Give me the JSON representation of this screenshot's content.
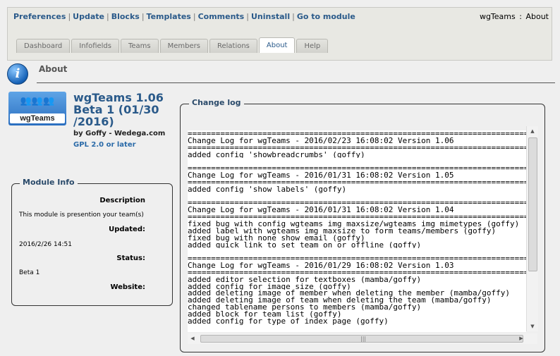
{
  "toplinks": [
    "Preferences",
    "Update",
    "Blocks",
    "Templates",
    "Comments",
    "Uninstall",
    "Go to module"
  ],
  "toplinks_sep": "|",
  "brand": {
    "module": "wgTeams",
    "sep": ":",
    "page": "About"
  },
  "tabs": [
    "Dashboard",
    "Infofields",
    "Teams",
    "Members",
    "Relations",
    "About",
    "Help"
  ],
  "active_tab": "About",
  "page_title": "About",
  "info_icon": {
    "name": "info-icon",
    "glyph": "i"
  },
  "logo": {
    "text": "wgTeams",
    "icon": "people-icon",
    "glyph": "👥👥👥"
  },
  "module": {
    "title": "wgTeams 1.06 Beta 1 (01/30 /2016)",
    "by": "by Goffy - Wedega.com",
    "license": "GPL 2.0 or later"
  },
  "module_info": {
    "legend": "Module Info",
    "description_label": "Description",
    "description": "This module is presention your team(s)",
    "updated_label": "Updated:",
    "updated": "2016/2/26 14:51",
    "status_label": "Status:",
    "status": "Beta 1",
    "website_label": "Website:"
  },
  "changelog": {
    "legend": "Change log",
    "lines": [
      "==========================================================================",
      "Change Log for wgTeams - 2016/02/23 16:08:02 Version 1.06",
      "==========================================================================",
      "added config 'showbreadcrumbs' (goffy)",
      "",
      "==========================================================================",
      "Change Log for wgTeams - 2016/01/31 16:08:02 Version 1.05",
      "==========================================================================",
      "added config 'show labels' (goffy)",
      "",
      "==========================================================================",
      "Change Log for wgTeams - 2016/01/31 16:08:02 Version 1.04",
      "==========================================================================",
      "fixed bug with config wgteams_img_maxsize/wgteams_img_mimetypes (goffy)",
      "added label with wgteams_img_maxsize to form teams/members (goffy)",
      "fixed bug with none show email (goffy)",
      "added quick link to set team on or offline (goffy)",
      "",
      "==========================================================================",
      "Change Log for wgTeams - 2016/01/29 16:08:02 Version 1.03",
      "==========================================================================",
      "added editor selection for textboxes (mamba/goffy)",
      "added config for image size (goffy)",
      "added deleting image of member when deleting the member (mamba/goffy)",
      "added deleting image of team when deleting the team (mamba/goffy)",
      "changed tablename persons to members (mamba/goffy)",
      "added block for team list (goffy)",
      "added config for type of index page (goffy)",
      "",
      ""
    ]
  },
  "scroll": {
    "up": "▲",
    "down": "▼",
    "left": "◀",
    "right": "▶",
    "grip": "|||"
  }
}
